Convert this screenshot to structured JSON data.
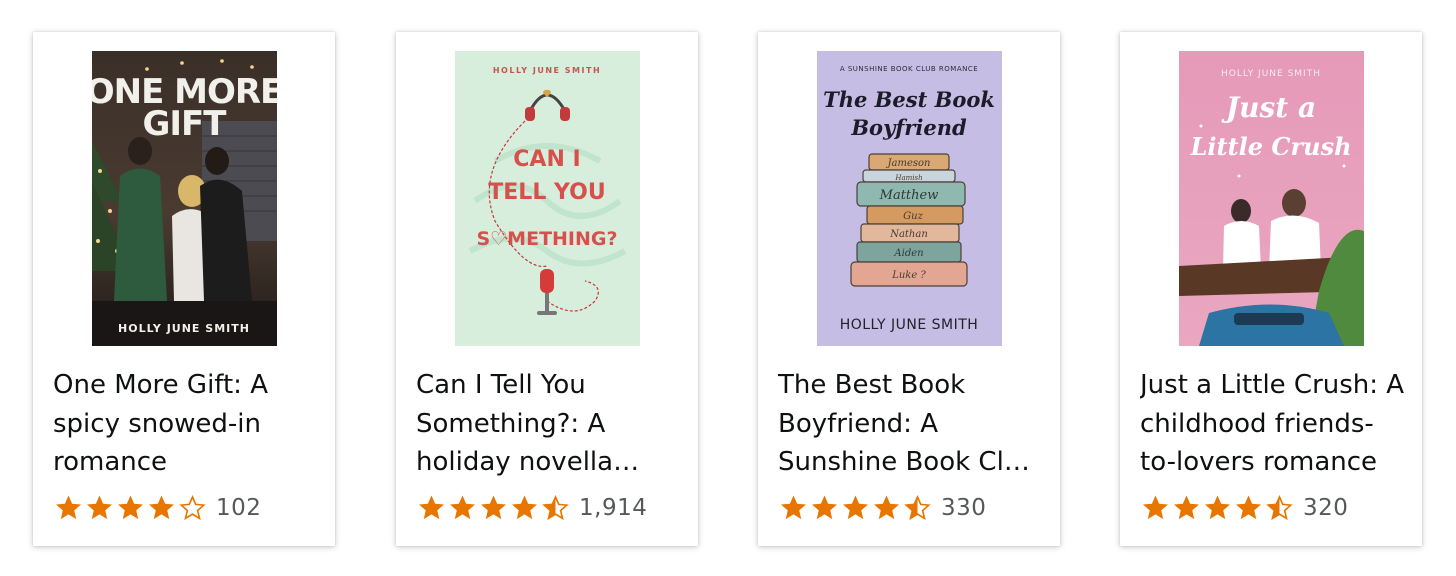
{
  "colors": {
    "star": "#E77600",
    "title": "#0F1111",
    "count": "#565959"
  },
  "books": [
    {
      "title": "One More Gift: A spicy snowed-in romance",
      "rating": 4.0,
      "review_count": "102",
      "cover": {
        "title_line1": "ONE MORE",
        "title_line2": "GIFT",
        "author": "HOLLY JUNE SMITH"
      }
    },
    {
      "title": "Can I Tell You Something?: A holiday novella (Holly June Smith)",
      "rating": 4.5,
      "review_count": "1,914",
      "cover": {
        "author": "HOLLY JUNE SMITH",
        "title_line1": "CAN I",
        "title_line2": "TELL YOU",
        "title_line3": "S♡METHING?"
      }
    },
    {
      "title": "The Best Book Boyfriend: A Sunshine Book Club Romance",
      "rating": 4.5,
      "review_count": "330",
      "cover": {
        "series": "A SUNSHINE BOOK CLUB ROMANCE",
        "title_line1": "The Best Book",
        "title_line2": "Boyfriend",
        "spines": [
          "Jameson",
          "Hamish",
          "Matthew",
          "Guz",
          "Nathan",
          "Aiden",
          "Luke ?"
        ],
        "author": "HOLLY JUNE SMITH"
      }
    },
    {
      "title": "Just a Little Crush: A childhood friends-to-lovers romance",
      "rating": 4.5,
      "review_count": "320",
      "cover": {
        "author": "HOLLY JUNE SMITH",
        "title_line1": "Just a",
        "title_line2": "Little Crush"
      }
    }
  ]
}
